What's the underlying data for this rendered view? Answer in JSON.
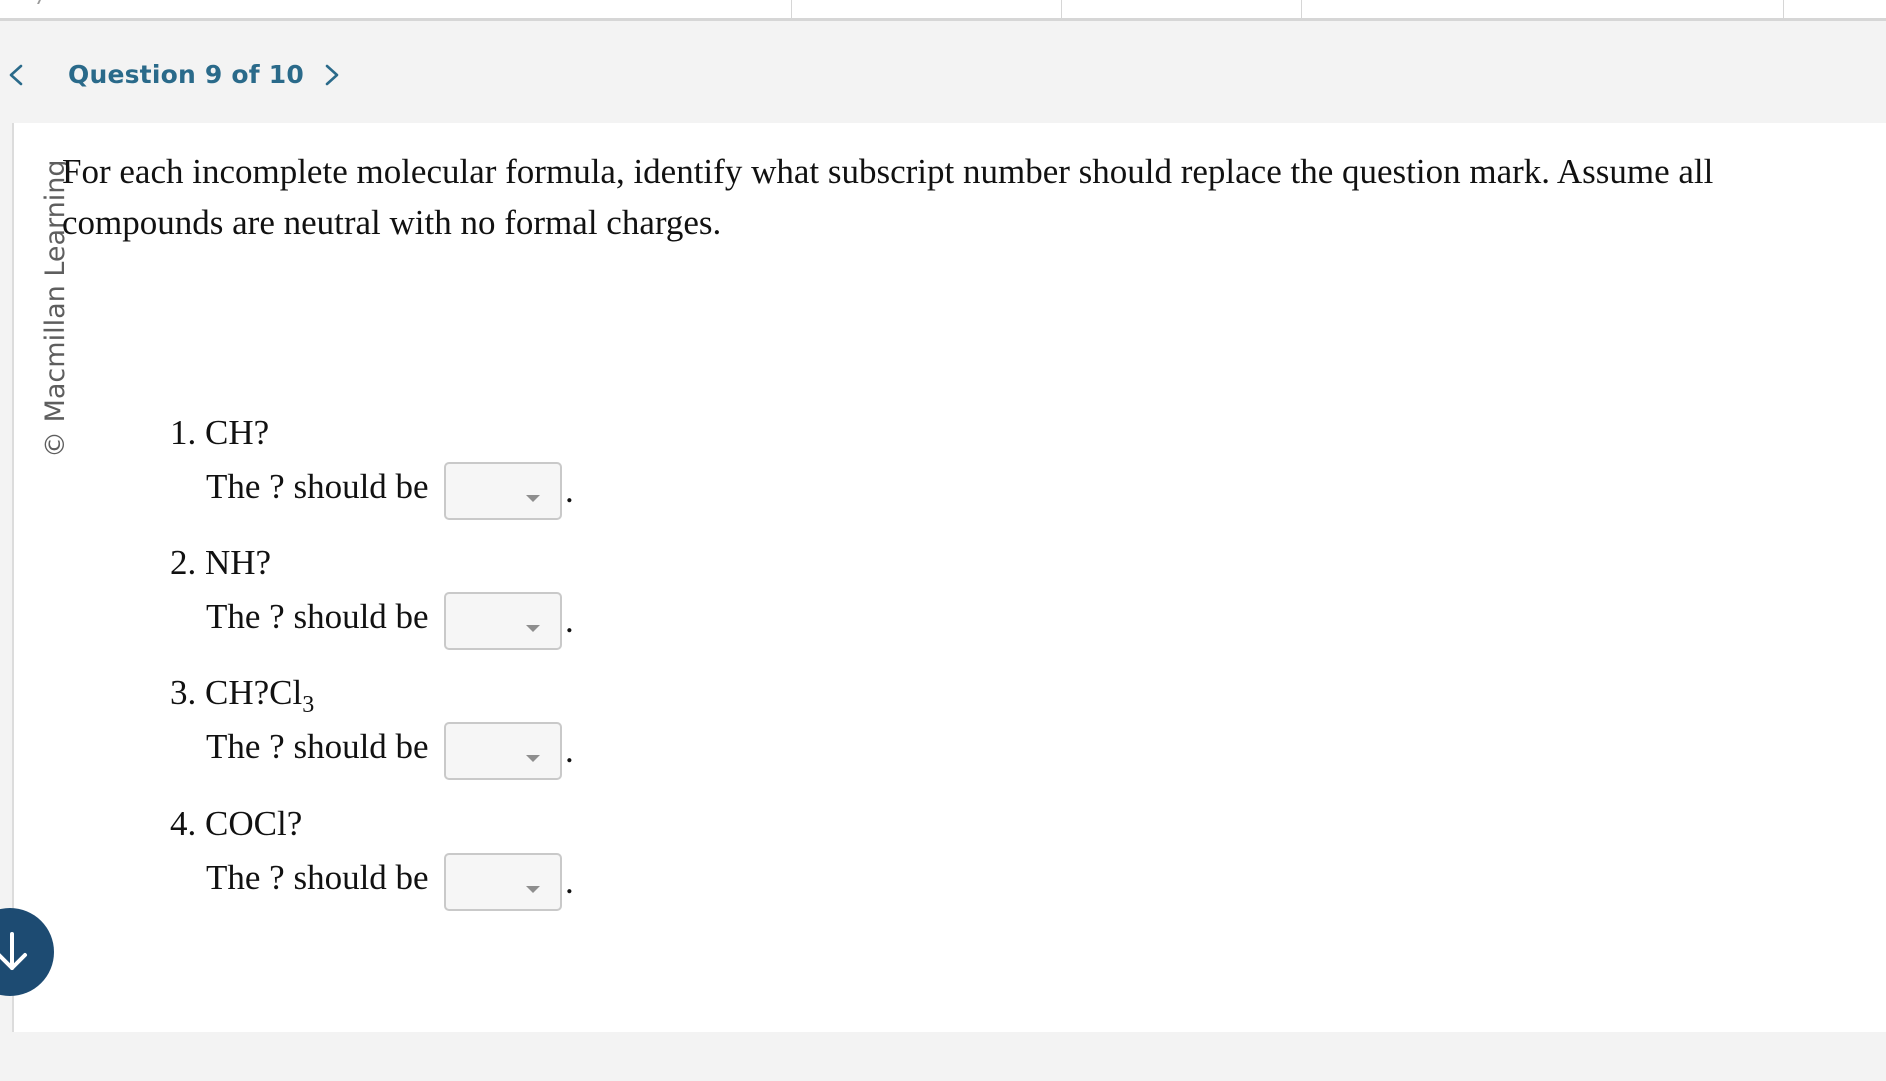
{
  "nav": {
    "counter": "Question 9 of 10",
    "prev_icon": "chevron-left-icon",
    "next_icon": "chevron-right-icon",
    "accent_color": "#2a6a8a"
  },
  "watermark": "© Macmillan Learning",
  "prompt": "For each incomplete molecular formula, identify what subscript number should replace the question mark. Assume all compounds are neutral with no formal charges.",
  "items": [
    {
      "number": "1.",
      "formula": "CH?",
      "subscript": "",
      "answer_label": "The ? should be",
      "selected": "",
      "suffix": "."
    },
    {
      "number": "2.",
      "formula": "NH?",
      "subscript": "",
      "answer_label": "The ? should be",
      "selected": "",
      "suffix": "."
    },
    {
      "number": "3.",
      "formula": "CH?Cl",
      "subscript": "3",
      "answer_label": "The ? should be",
      "selected": "",
      "suffix": "."
    },
    {
      "number": "4.",
      "formula": "COCl?",
      "subscript": "",
      "answer_label": "The ? should be",
      "selected": "",
      "suffix": "."
    }
  ],
  "scroll_button": {
    "icon": "arrow-down-icon",
    "color": "#1d4b72"
  }
}
